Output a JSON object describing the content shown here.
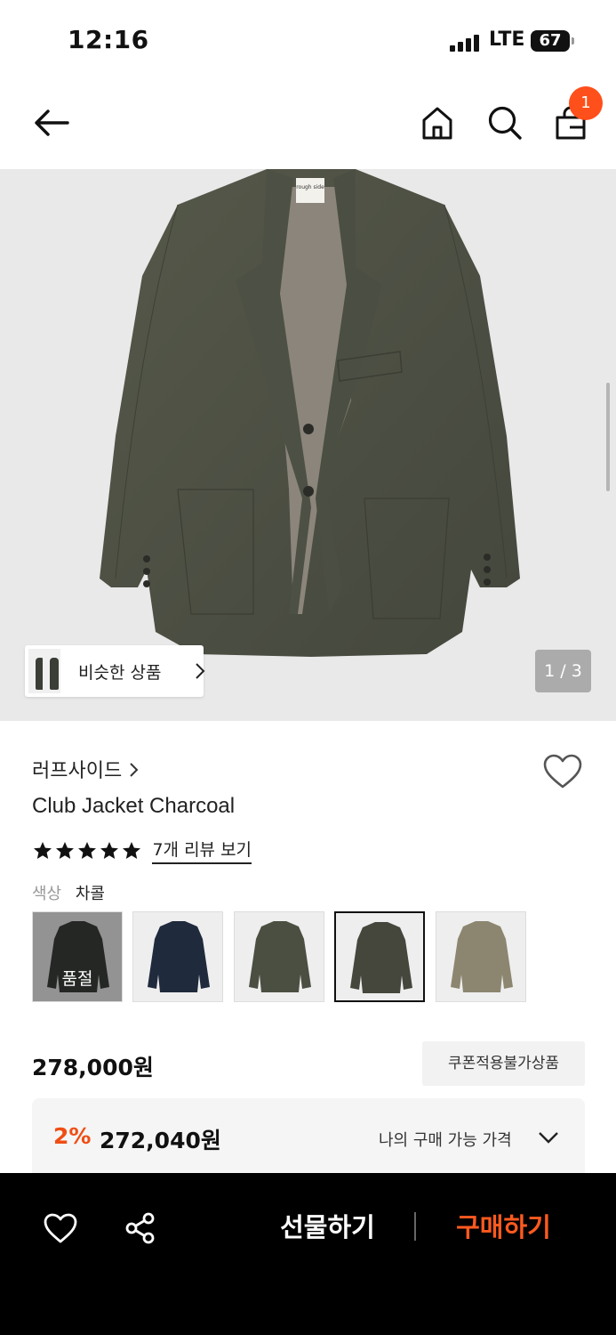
{
  "status_bar": {
    "time": "12:16",
    "network": "LTE",
    "battery": "67"
  },
  "header": {
    "cart_count": "1",
    "icons": [
      "back-arrow-icon",
      "home-icon",
      "search-icon",
      "shopping-bag-icon"
    ]
  },
  "gallery": {
    "similar_label": "비슷한 상품",
    "page_indicator": "1 / 3",
    "tag_text": "rough side"
  },
  "product": {
    "brand": "러프사이드",
    "name": "Club Jacket Charcoal",
    "rating_stars": 5,
    "review_link": "7개 리뷰 보기",
    "color_label": "색상",
    "color_value": "차콜",
    "swatches": [
      {
        "color": "#3d3f3c",
        "sold_out": true,
        "sold_out_label": "품절"
      },
      {
        "color": "#1f2a3d",
        "sold_out": false
      },
      {
        "color": "#4a4f42",
        "sold_out": false
      },
      {
        "color": "#45473d",
        "sold_out": false,
        "selected": true
      },
      {
        "color": "#8c8670",
        "sold_out": false
      }
    ],
    "price": "278,000원",
    "coupon_tag": "쿠폰적용불가상품",
    "discount_rate": "2%",
    "discount_price": "272,040원",
    "my_price_label": "나의 구매 가능 가격"
  },
  "bottom_bar": {
    "gift_label": "선물하기",
    "buy_label": "구매하기"
  },
  "colors": {
    "accent": "#ff5a1f",
    "badge": "#ff4f1a",
    "jacket": "#4b4e44"
  }
}
